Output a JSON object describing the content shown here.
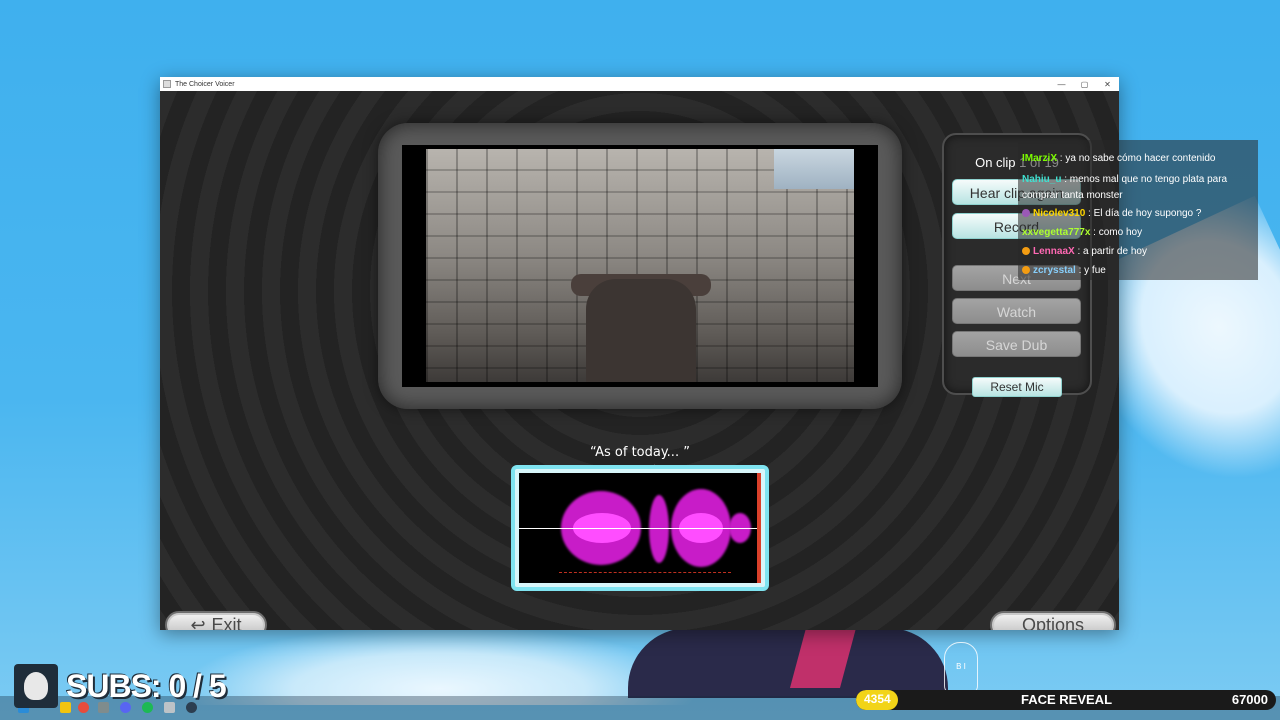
{
  "window": {
    "title": "The Choicer Voicer",
    "controls": [
      "—",
      "▢",
      "✕"
    ]
  },
  "panel": {
    "clip_counter": "On clip 1 of 19",
    "buttons": {
      "hear_clip": "Hear clip again",
      "record": "Record",
      "next": "Next",
      "watch": "Watch",
      "save_dub": "Save Dub",
      "reset_mic": "Reset Mic"
    }
  },
  "subtitle": "“As of today... ”",
  "bottom": {
    "exit": "Exit",
    "options": "Options"
  },
  "chat": [
    {
      "user": "IMarziX",
      "color": "#7CFC00",
      "message": " : ya no sabe cómo hacer contenido"
    },
    {
      "user": "Nahiu_u",
      "color": "#40e0d0",
      "message": " : menos mal que no tengo plata para comprar tanta monster"
    },
    {
      "user": "Nicolev310",
      "color": "#ffd700",
      "message": " : El día de hoy supongo ?"
    },
    {
      "user": "xxvegetta777x",
      "color": "#adff2f",
      "message": " : como hoy"
    },
    {
      "user": "LennaaX",
      "color": "#ff69b4",
      "message": " : a partir de hoy"
    },
    {
      "user": "zcrysstal",
      "color": "#87cefa",
      "message": " : y fue"
    }
  ],
  "overlay": {
    "subs": "SUBS: 0 / 5",
    "goal_current": "4354",
    "goal_title": "FACE REVEAL",
    "goal_target": "67000",
    "goal_progress": 0.065,
    "bunny_text": "B I"
  },
  "colors": {
    "accent_teal": "#7fe3f0",
    "waveform": "#c81cc8",
    "goal_yellow": "#f2d418"
  }
}
